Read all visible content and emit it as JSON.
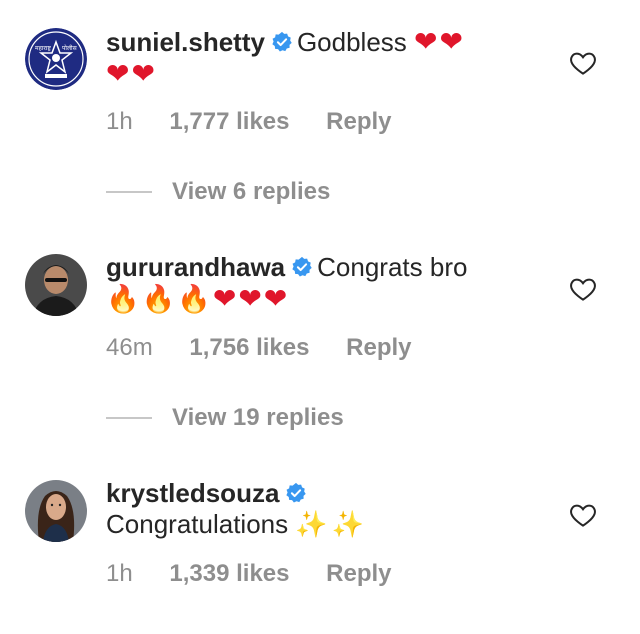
{
  "comments": [
    {
      "username": "suniel.shetty",
      "text": "Godbless",
      "emoji_hearts_inline": "❤❤",
      "emoji_line2": "❤❤",
      "time": "1h",
      "likes": "1,777 likes",
      "reply": "Reply",
      "avatar_icon": "police-badge-icon"
    },
    {
      "username": "gururandhawa",
      "text": "Congrats bro",
      "emoji_fire": "🔥🔥🔥",
      "emoji_hearts": "❤❤❤",
      "time": "46m",
      "likes": "1,756 likes",
      "reply": "Reply",
      "avatar_icon": "profile-photo"
    },
    {
      "username": "krystledsouza",
      "text": "Congratulations",
      "emoji_spark": "✨✨",
      "time": "1h",
      "likes": "1,339 likes",
      "reply": "Reply",
      "avatar_icon": "profile-photo"
    }
  ],
  "view_replies": [
    "View 6 replies",
    "View 19 replies"
  ],
  "colors": {
    "text": "#262626",
    "muted": "#8e8e8e",
    "verified": "#3897f0",
    "heart": "#e0162b"
  }
}
